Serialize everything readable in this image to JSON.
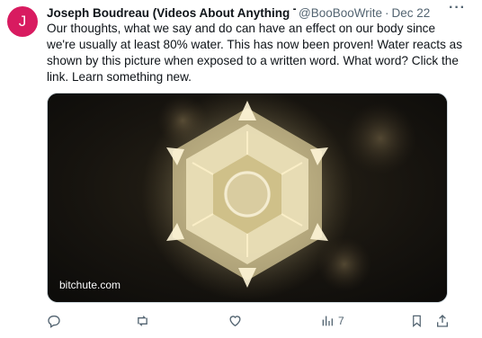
{
  "tweet": {
    "avatar_letter": "J",
    "avatar_color": "#d81b60",
    "display_name": "Joseph Boudreau (Videos About Anything T\\",
    "handle": "@BooBooWrite",
    "separator": "·",
    "date": "Dec 22",
    "more_label": "···",
    "text": "Our thoughts, what we say and do can have an effect on our body since we're usually at least 80% water. This has now been proven! Water reacts as shown by this picture when exposed to a written word. What word? Click the link. Learn something new.",
    "media": {
      "link_domain": "bitchute.com",
      "image_subject": "water crystal"
    },
    "actions": {
      "reply_icon": "reply-icon",
      "retweet_icon": "retweet-icon",
      "like_icon": "like-icon",
      "views_icon": "views-icon",
      "views_count": "7",
      "bookmark_icon": "bookmark-icon",
      "share_icon": "share-icon"
    }
  },
  "colors": {
    "text_primary": "#0f1419",
    "text_secondary": "#536471",
    "border": "#cfd9de"
  }
}
